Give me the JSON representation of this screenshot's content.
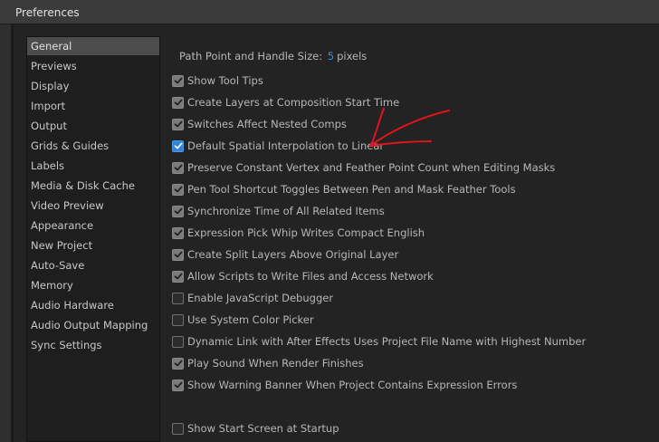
{
  "window": {
    "title": "Preferences"
  },
  "sidebar": {
    "items": [
      {
        "label": "General",
        "selected": true
      },
      {
        "label": "Previews"
      },
      {
        "label": "Display"
      },
      {
        "label": "Import"
      },
      {
        "label": "Output"
      },
      {
        "label": "Grids & Guides"
      },
      {
        "label": "Labels"
      },
      {
        "label": "Media & Disk Cache"
      },
      {
        "label": "Video Preview"
      },
      {
        "label": "Appearance"
      },
      {
        "label": "New Project"
      },
      {
        "label": "Auto-Save"
      },
      {
        "label": "Memory"
      },
      {
        "label": "Audio Hardware"
      },
      {
        "label": "Audio Output Mapping"
      },
      {
        "label": "Sync Settings"
      }
    ]
  },
  "general": {
    "path_point_label": "Path Point and Handle Size:",
    "path_point_value": "5",
    "path_point_unit": "pixels",
    "options": [
      {
        "label": "Show Tool Tips",
        "checked": true
      },
      {
        "label": "Create Layers at Composition Start Time",
        "checked": true
      },
      {
        "label": "Switches Affect Nested Comps",
        "checked": true
      },
      {
        "label": "Default Spatial Interpolation to Linear",
        "checked": true,
        "accent": true
      },
      {
        "label": "Preserve Constant Vertex and Feather Point Count when Editing Masks",
        "checked": true
      },
      {
        "label": "Pen Tool Shortcut Toggles Between Pen and Mask Feather Tools",
        "checked": true
      },
      {
        "label": "Synchronize Time of All Related Items",
        "checked": true
      },
      {
        "label": "Expression Pick Whip Writes Compact English",
        "checked": true
      },
      {
        "label": "Create Split Layers Above Original Layer",
        "checked": true
      },
      {
        "label": "Allow Scripts to Write Files and Access Network",
        "checked": true
      },
      {
        "label": "Enable JavaScript Debugger",
        "checked": false
      },
      {
        "label": "Use System Color Picker",
        "checked": false
      },
      {
        "label": "Dynamic Link with After Effects Uses Project File Name with Highest Number",
        "checked": false
      },
      {
        "label": "Play Sound When Render Finishes",
        "checked": true
      },
      {
        "label": "Show Warning Banner When Project Contains Expression Errors",
        "checked": true
      },
      {
        "label": "Show Start Screen at Startup",
        "checked": false
      }
    ]
  },
  "colors": {
    "accent_checkbox": "#2f86d8",
    "annotation_red": "#e0141e"
  }
}
